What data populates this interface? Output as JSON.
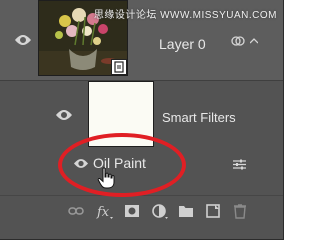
{
  "watermark": "思缘设计论坛 WWW.MISSYUAN.COM",
  "layer": {
    "name": "Layer 0"
  },
  "smart_filters": {
    "label": "Smart Filters"
  },
  "filter": {
    "name": "Oil Paint"
  },
  "colors": {
    "panel": "#535353",
    "highlight_oval": "#e01f24",
    "text": "#e8e8e8"
  },
  "bottom_bar": [
    "link-icon",
    "fx-icon",
    "mask-icon",
    "adjustment-icon",
    "folder-icon",
    "new-layer-icon",
    "trash-icon"
  ]
}
